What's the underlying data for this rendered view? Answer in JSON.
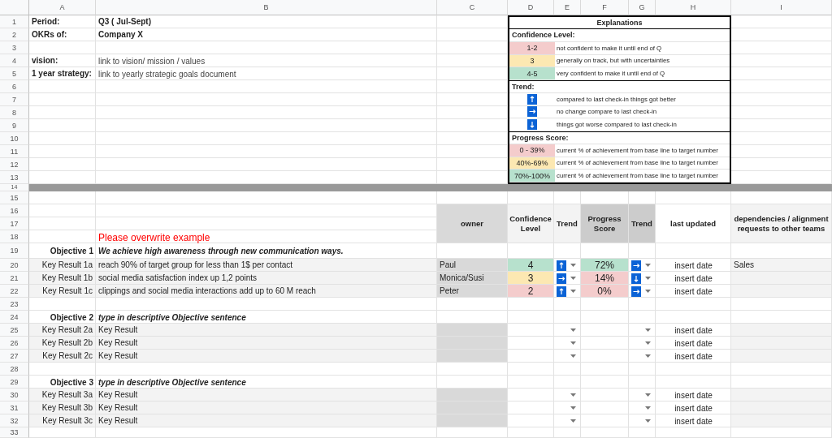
{
  "column_headers": [
    "A",
    "B",
    "C",
    "D",
    "E",
    "F",
    "G",
    "H",
    "I"
  ],
  "row_headers": [
    "1",
    "2",
    "3",
    "4",
    "5",
    "6",
    "7",
    "8",
    "9",
    "10",
    "11",
    "12",
    "13",
    "14",
    "15",
    "16",
    "17",
    "18",
    "19",
    "20",
    "21",
    "22",
    "23",
    "24",
    "25",
    "26",
    "27",
    "28",
    "29",
    "30",
    "31",
    "32",
    "33"
  ],
  "header_info": [
    {
      "label": "Period:",
      "value": "Q3 ( Jul-Sept)",
      "kind": "bold"
    },
    {
      "label": "OKRs of:",
      "value": "Company X",
      "kind": "bold"
    },
    {
      "label": "vision:",
      "value": "link to vision/ mission / values",
      "kind": "link"
    },
    {
      "label": "1 year strategy:",
      "value": "link to yearly strategic goals document",
      "kind": "link"
    }
  ],
  "explanations": {
    "title": "Explanations",
    "sections": [
      {
        "heading": "Confidence Level:",
        "items": [
          {
            "kind": "swatch",
            "key": "1-2",
            "color": "#f4cccc",
            "description": "not confident to make it until end of Q"
          },
          {
            "kind": "swatch",
            "key": "3",
            "color": "#fce8b2",
            "description": "generally on track, but with uncertainties"
          },
          {
            "kind": "swatch",
            "key": "4-5",
            "color": "#b7e1cd",
            "description": "very confident to make it until end of Q"
          }
        ]
      },
      {
        "heading": "Trend:",
        "items": [
          {
            "kind": "up",
            "description": "compared to last check-in things got better"
          },
          {
            "kind": "flat",
            "description": "no change compare to last check-in"
          },
          {
            "kind": "down",
            "description": "things got worse compared to last check-in"
          }
        ]
      },
      {
        "heading": "Progress Score:",
        "items": [
          {
            "kind": "swatch",
            "key": "0 - 39%",
            "color": "#f4cccc",
            "description": "current % of achievement from base line to target number"
          },
          {
            "kind": "swatch",
            "key": "40%-69%",
            "color": "#fce8b2",
            "description": "current % of achievement from base line to target number"
          },
          {
            "kind": "swatch",
            "key": "70%-100%",
            "color": "#b7e1cd",
            "description": "current % of achievement from base line to target number"
          }
        ]
      }
    ]
  },
  "note": "Please overwrite example",
  "table_header": [
    "owner",
    "Confidence Level",
    "Trend",
    "Progress Score",
    "Trend",
    "last updated",
    "dependencies / alignment requests to other teams"
  ],
  "objectives": [
    {
      "label": "Objective 1",
      "text": "We achieve high awareness through new communication ways.",
      "key_results": [
        {
          "label": "Key Result 1a",
          "text": "reach 90% of target group for less than 1$ per contact",
          "owner": "Paul",
          "confidence": {
            "text": "4",
            "color": "#b7e1cd"
          },
          "trend": {
            "kind": "up"
          },
          "progress": {
            "text": "72%",
            "color": "#b7e1cd"
          },
          "progress_trend": {
            "kind": "flat"
          },
          "last_updated": "insert date",
          "dependencies": "Sales"
        },
        {
          "label": "Key Result 1b",
          "text": "social media satisfaction index up 1,2 points",
          "owner": "Monica/Susi",
          "confidence": {
            "text": "3",
            "color": "#fce8b2"
          },
          "trend": {
            "kind": "flat"
          },
          "progress": {
            "text": "14%",
            "color": "#f4cccc"
          },
          "progress_trend": {
            "kind": "down"
          },
          "last_updated": "insert date"
        },
        {
          "label": "Key Result 1c",
          "text": "clippings and social media interactions add up to 60 M reach",
          "owner": "Peter",
          "confidence": {
            "text": "2",
            "color": "#f4cccc"
          },
          "trend": {
            "kind": "up"
          },
          "progress": {
            "text": "0%",
            "color": "#f4cccc"
          },
          "progress_trend": {
            "kind": "flat"
          },
          "last_updated": "insert date"
        }
      ]
    },
    {
      "label": "Objective 2",
      "text": "type in descriptive Objective sentence",
      "key_results": [
        {
          "label": "Key Result 2a",
          "text": "Key Result",
          "last_updated": "insert date"
        },
        {
          "label": "Key Result 2b",
          "text": "Key Result",
          "last_updated": "insert date"
        },
        {
          "label": "Key Result 2c",
          "text": "Key Result",
          "last_updated": "insert date"
        }
      ]
    },
    {
      "label": "Objective 3",
      "text": "type in descriptive Objective sentence",
      "key_results": [
        {
          "label": "Key Result 3a",
          "text": "Key Result",
          "last_updated": "insert date"
        },
        {
          "label": "Key Result 3b",
          "text": "Key Result",
          "last_updated": "insert date"
        },
        {
          "label": "Key Result 3c",
          "text": "Key Result",
          "last_updated": "insert date"
        }
      ]
    }
  ]
}
